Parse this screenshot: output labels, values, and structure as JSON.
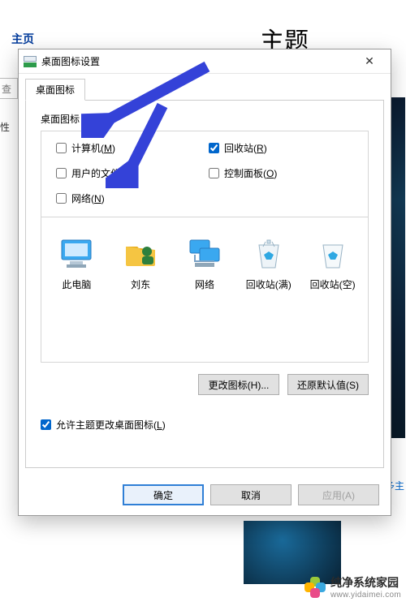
{
  "bg": {
    "header": "主页",
    "title": "主题",
    "search": "查",
    "side_label0": "性",
    "side_link": "多主"
  },
  "dialog": {
    "title": "桌面图标设置",
    "tab": "桌面图标",
    "group_label": "桌面图标",
    "checks": {
      "computer": {
        "label": "计算机",
        "hot": "M",
        "checked": false
      },
      "recycle": {
        "label": "回收站",
        "hot": "R",
        "checked": true
      },
      "userfiles": {
        "label": "用户的文件",
        "hot": "U",
        "checked": false
      },
      "control": {
        "label": "控制面板",
        "hot": "O",
        "checked": false
      },
      "network": {
        "label": "网络",
        "hot": "N",
        "checked": false
      }
    },
    "icons": {
      "pc": "此电脑",
      "user": "刘东",
      "net": "网络",
      "binfull": "回收站(满)",
      "binempty": "回收站(空)"
    },
    "change_icon_label": "更改图标(H)...",
    "restore_label": "还原默认值(S)",
    "allow_theme_label": "允许主题更改桌面图标",
    "allow_theme_hot": "L",
    "allow_theme_checked": true,
    "ok": "确定",
    "cancel": "取消",
    "apply": "应用(A)"
  },
  "watermark": {
    "line1": "纯净系统家园",
    "line2": "www.yidaimei.com"
  }
}
